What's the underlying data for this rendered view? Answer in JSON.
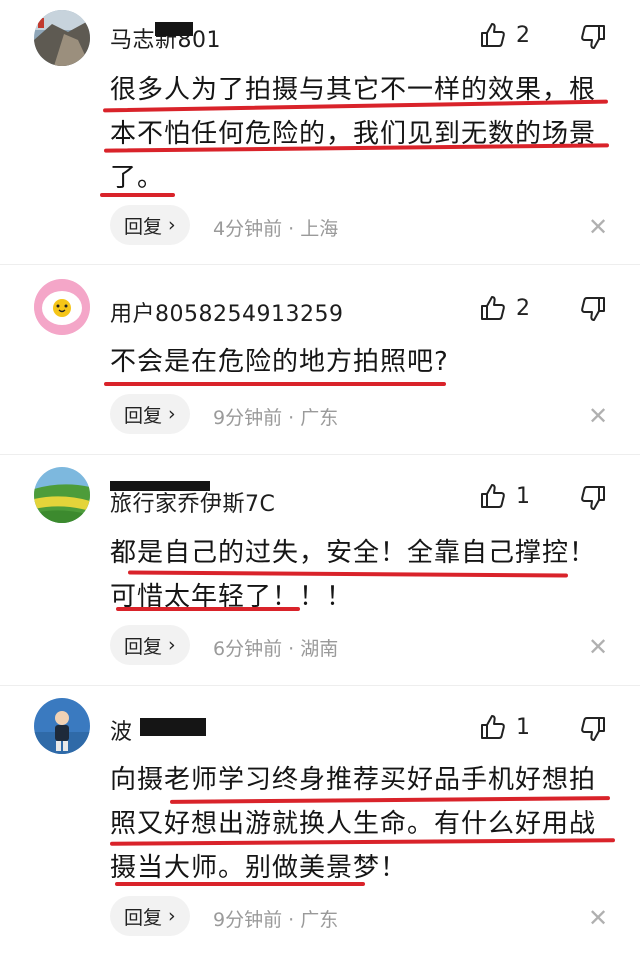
{
  "comments": [
    {
      "username": "马志新801",
      "likes": "2",
      "text_lines": [
        "很多人为了拍摄与其它不一样的效果，根",
        "本不怕任何危险的，我们见到无数的场景",
        "了。"
      ],
      "reply_label": "回复",
      "time": "4分钟前",
      "location": "上海",
      "avatar_icon": "landscape-avatar-icon"
    },
    {
      "username": "用户8058254913259",
      "likes": "2",
      "text_lines": [
        "不会是在危险的地方拍照吧?"
      ],
      "reply_label": "回复",
      "time": "9分钟前",
      "location": "广东",
      "avatar_icon": "egg-avatar-icon"
    },
    {
      "username": "旅行家乔伊斯7C",
      "likes": "1",
      "text_lines": [
        "都是自己的过失，安全！全靠自己撑控！",
        "可惜太年轻了！！！"
      ],
      "reply_label": "回复",
      "time": "6分钟前",
      "location": "湖南",
      "avatar_icon": "field-avatar-icon"
    },
    {
      "username": "波",
      "likes": "1",
      "text_lines": [
        "向摄老师学习终身推荐买好品手机好想拍",
        "照又好想出游就换人生命。有什么好用战",
        "摄当大师。别做美景梦！"
      ],
      "reply_label": "回复",
      "time": "9分钟前",
      "location": "广东",
      "avatar_icon": "person-avatar-icon"
    }
  ],
  "meta_separator": "·",
  "colors": {
    "annotation_red": "#d9232a",
    "meta_gray": "#9a9a9a",
    "reply_bg": "#f2f2f2"
  }
}
